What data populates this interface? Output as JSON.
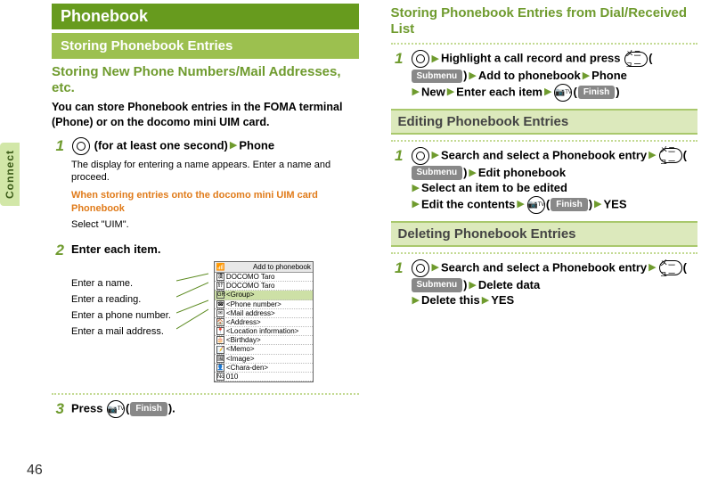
{
  "sideTab": "Connect",
  "pageNumber": "46",
  "left": {
    "title": "Phonebook",
    "subtitle": "Storing Phonebook Entries",
    "headline": "Storing New Phone Numbers/Mail Addresses, etc.",
    "lead": "You can store Phonebook entries in the FOMA terminal (Phone) or on the docomo mini UIM card.",
    "step1_num": "1",
    "step1_icon_inner": "",
    "step1_part1": " (for at least one second)",
    "step1_part2": "Phone",
    "step1_note": "The display for entering a name appears. Enter a name and proceed.",
    "step1_orange": "When storing entries onto the docomo mini UIM card Phonebook",
    "step1_orange_sub": "Select \"UIM\".",
    "step2_num": "2",
    "step2_text": "Enter each item.",
    "labels": {
      "l1": "Enter a name.",
      "l2": "Enter a reading.",
      "l3": "Enter a phone number.",
      "l4": "Enter a mail address."
    },
    "screen": {
      "hdr_left": "",
      "hdr_right": "Add to phonebook",
      "r1": "DOCOMO Taro",
      "r2": "DOCOMO Taro",
      "r3": "<Group>",
      "r4": "<Phone number>",
      "r5": "<Mail address>",
      "r6": "<Address>",
      "r7": "<Location information>",
      "r8": "<Birthday>",
      "r9": "<Memo>",
      "r10": "<Image>",
      "r11": "<Chara-den>",
      "r12": "010"
    },
    "step3_num": "3",
    "step3_a": "Press ",
    "step3_btn_inner": "",
    "step3_c": "(",
    "step3_pill": "Finish",
    "step3_e": ")."
  },
  "right": {
    "headline": "Storing Phonebook Entries from Dial/Received List",
    "s1_num": "1",
    "s1_a": "Highlight a call record and press ",
    "s1_menu_label": "メニュー",
    "s1_b": "(",
    "s1_pill1": "Submenu",
    "s1_c": ")",
    "s1_d": "Add to phonebook",
    "s1_e": "Phone",
    "s1_f": "New",
    "s1_g": "Enter each item",
    "s1_h": "(",
    "s1_pill2": "Finish",
    "s1_i": ")",
    "edit_hdr": "Editing Phonebook Entries",
    "e1_num": "1",
    "e1_a": "Search and select a Phonebook entry",
    "e1_menu_label": "メニュー",
    "e1_b": "(",
    "e1_pill1": "Submenu",
    "e1_c": ")",
    "e1_d": "Edit phonebook",
    "e1_e": "Select an item to be edited",
    "e1_f": "Edit the contents",
    "e1_g": "(",
    "e1_pill2": "Finish",
    "e1_h": ")",
    "e1_i": "YES",
    "del_hdr": "Deleting Phonebook Entries",
    "d1_num": "1",
    "d1_a": "Search and select a Phonebook entry",
    "d1_menu_label": "メニュー",
    "d1_b": "(",
    "d1_pill1": "Submenu",
    "d1_c": ")",
    "d1_d": "Delete data",
    "d1_e": "Delete this",
    "d1_f": "YES"
  }
}
